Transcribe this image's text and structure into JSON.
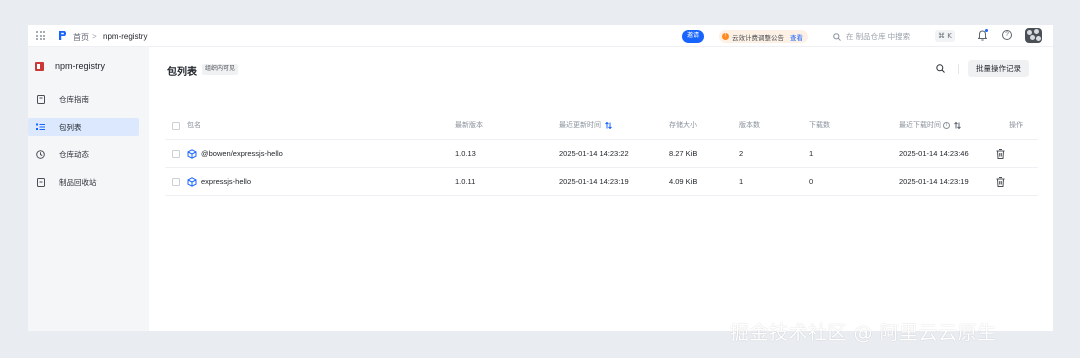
{
  "topbar": {
    "breadcrumb_home": "首页",
    "breadcrumb_sep": ">",
    "breadcrumb_current": "npm-registry",
    "invite_label": "邀请",
    "notice_text": "云效计费调整公告",
    "notice_view": "查看",
    "search_placeholder": "在 制品仓库 中搜索",
    "shortcut": "⌘ K",
    "help_glyph": "?"
  },
  "sidebar": {
    "repo_name": "npm-registry",
    "items": [
      {
        "label": "仓库指南",
        "icon": "book-icon"
      },
      {
        "label": "包列表",
        "icon": "list-icon",
        "active": true
      },
      {
        "label": "仓库动态",
        "icon": "history-icon"
      },
      {
        "label": "制品回收站",
        "icon": "recycle-bin-icon"
      }
    ]
  },
  "main": {
    "title": "包列表",
    "scope_badge": "组织内可见",
    "batch_button": "批量操作记录",
    "columns": [
      "包名",
      "最新版本",
      "最近更新时间",
      "存储大小",
      "版本数",
      "下载数",
      "最近下载时间",
      "操作"
    ],
    "rows": [
      {
        "name": "@bowen/expressjs-hello",
        "version": "1.0.13",
        "updated": "2025-01-14 14:23:22",
        "size": "8.27 KiB",
        "versions": "2",
        "downloads": "1",
        "last_download": "2025-01-14 14:23:46"
      },
      {
        "name": "expressjs-hello",
        "version": "1.0.11",
        "updated": "2025-01-14 14:23:19",
        "size": "4.09 KiB",
        "versions": "1",
        "downloads": "0",
        "last_download": "2025-01-14 14:23:19"
      }
    ]
  },
  "watermark": "掘金技术社区 @ 阿里云云原生",
  "colors": {
    "accent": "#1764ff",
    "active_nav": "#dbe8fd",
    "npm_red": "#cb3837",
    "notice_orange": "#ff8b1f"
  }
}
